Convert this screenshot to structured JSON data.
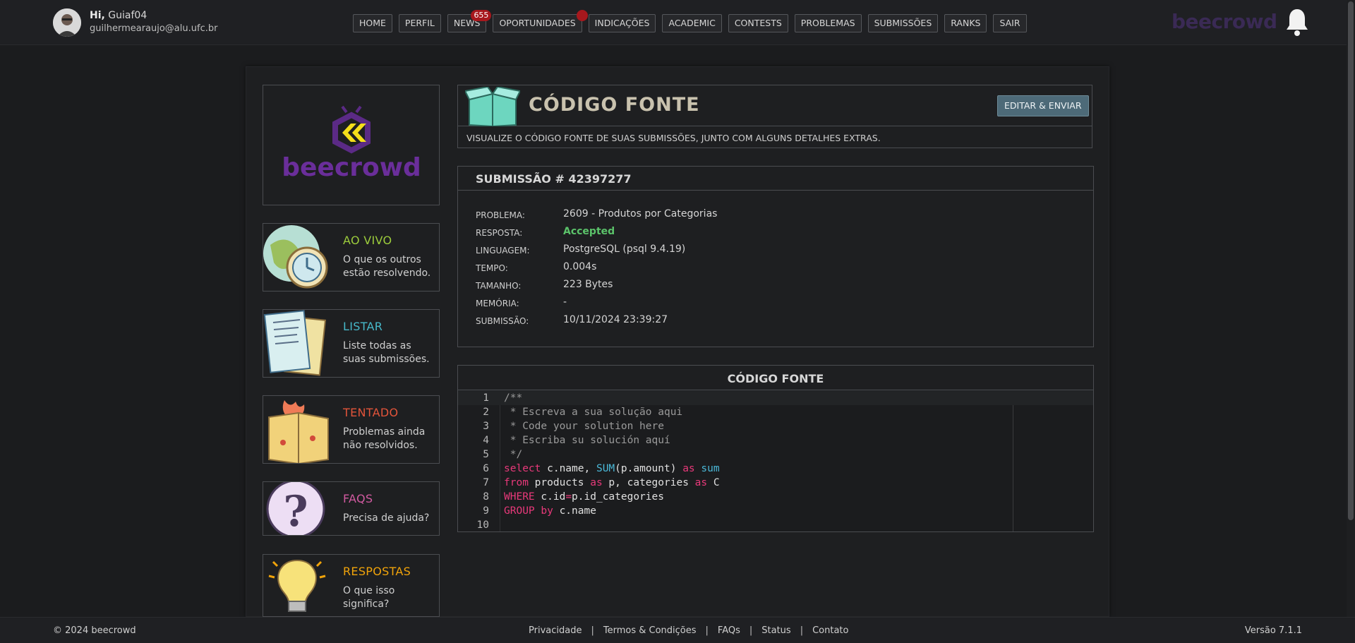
{
  "user": {
    "greeting_prefix": "Hi,",
    "name": "Guiaf04",
    "email": "guilhermearaujo@alu.ufc.br"
  },
  "nav": [
    {
      "label": "HOME"
    },
    {
      "label": "PERFIL"
    },
    {
      "label": "NEWS",
      "badge": "655"
    },
    {
      "label": "OPORTUNIDADES",
      "dot": true
    },
    {
      "label": "INDICAÇÕES"
    },
    {
      "label": "ACADEMIC"
    },
    {
      "label": "CONTESTS"
    },
    {
      "label": "PROBLEMAS"
    },
    {
      "label": "SUBMISSÕES"
    },
    {
      "label": "RANKS"
    },
    {
      "label": "SAIR"
    }
  ],
  "brand": "beecrowd",
  "sidebar": {
    "logo_text": "beecrowd",
    "cards": [
      {
        "title": "AO VIVO",
        "desc": "O que os outros estão resolvendo.",
        "color": "#9ccc3c"
      },
      {
        "title": "LISTAR",
        "desc": "Liste todas as suas submissões.",
        "color": "#47b8c9"
      },
      {
        "title": "TENTADO",
        "desc": "Problemas ainda não resolvidos.",
        "color": "#e2543a"
      },
      {
        "title": "FAQS",
        "desc": "Precisa de ajuda?",
        "color": "#d15aa0"
      },
      {
        "title": "RESPOSTAS",
        "desc": "O que isso significa?",
        "color": "#f0a30a"
      }
    ]
  },
  "header": {
    "title": "CÓDIGO FONTE",
    "button": "EDITAR & ENVIAR",
    "subtitle": "VISUALIZE O CÓDIGO FONTE DE SUAS SUBMISSÕES, JUNTO COM ALGUNS DETALHES EXTRAS."
  },
  "submission": {
    "title": "SUBMISSÃO # 42397277",
    "rows": [
      {
        "key": "PROBLEMA:",
        "value": "2609 - Produtos por Categorias"
      },
      {
        "key": "RESPOSTA:",
        "value": "Accepted"
      },
      {
        "key": "LINGUAGEM:",
        "value": "PostgreSQL (psql 9.4.19)"
      },
      {
        "key": "TEMPO:",
        "value": "0.004s"
      },
      {
        "key": "TAMANHO:",
        "value": "223 Bytes"
      },
      {
        "key": "MEMÓRIA:",
        "value": "-"
      },
      {
        "key": "SUBMISSÃO:",
        "value": "10/11/2024 23:39:27"
      }
    ]
  },
  "code": {
    "title": "CÓDIGO FONTE",
    "lines": [
      [
        {
          "t": "/**",
          "c": "cm"
        }
      ],
      [
        {
          "t": " * Escreva a sua solução aqui",
          "c": "cm"
        }
      ],
      [
        {
          "t": " * Code your solution here",
          "c": "cm"
        }
      ],
      [
        {
          "t": " * Escriba su solución aquí",
          "c": "cm"
        }
      ],
      [
        {
          "t": " */",
          "c": "cm"
        }
      ],
      [
        {
          "t": "select",
          "c": "kw"
        },
        {
          "t": " c.name, "
        },
        {
          "t": "SUM",
          "c": "fn"
        },
        {
          "t": "(p.amount) "
        },
        {
          "t": "as",
          "c": "kw"
        },
        {
          "t": " "
        },
        {
          "t": "sum",
          "c": "fn"
        }
      ],
      [
        {
          "t": "from",
          "c": "kw"
        },
        {
          "t": " products "
        },
        {
          "t": "as",
          "c": "kw"
        },
        {
          "t": " p, categories "
        },
        {
          "t": "as",
          "c": "kw"
        },
        {
          "t": " C"
        }
      ],
      [
        {
          "t": "WHERE",
          "c": "kw"
        },
        {
          "t": " c.id"
        },
        {
          "t": "=",
          "c": "kw"
        },
        {
          "t": "p.id_categories"
        }
      ],
      [
        {
          "t": "GROUP by",
          "c": "kw"
        },
        {
          "t": " c.name"
        }
      ],
      []
    ]
  },
  "footer": {
    "copyright": "© 2024 beecrowd",
    "links": [
      "Privacidade",
      "Termos & Condições",
      "FAQs",
      "Status",
      "Contato"
    ],
    "version": "Versão 7.1.1"
  }
}
